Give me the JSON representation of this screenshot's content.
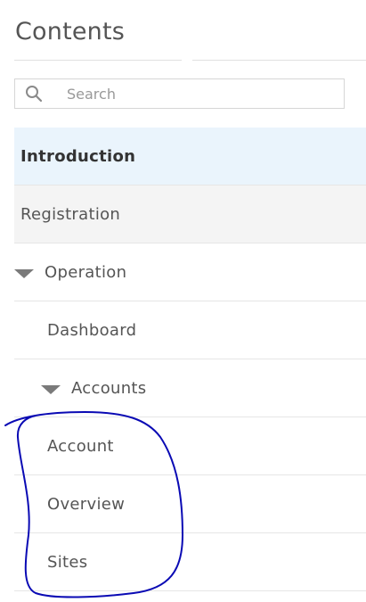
{
  "sidebar": {
    "title": "Contents",
    "search": {
      "placeholder": "Search",
      "icon": "search-icon"
    },
    "items": [
      {
        "label": "Introduction",
        "state": "active"
      },
      {
        "label": "Registration",
        "state": "shaded"
      },
      {
        "label": "Operation",
        "state": "expanded",
        "icon": "caret-down-icon"
      },
      {
        "label": "Dashboard",
        "state": "normal"
      },
      {
        "label": "Accounts",
        "state": "expanded",
        "icon": "caret-down-icon"
      },
      {
        "label": "Account",
        "state": "normal"
      },
      {
        "label": "Overview",
        "state": "normal"
      },
      {
        "label": "Sites",
        "state": "normal"
      }
    ]
  },
  "colors": {
    "active_bg": "#eaf4fc",
    "shaded_bg": "#f4f4f4",
    "text": "#555555",
    "annotation_ink": "#0a0ab4"
  }
}
